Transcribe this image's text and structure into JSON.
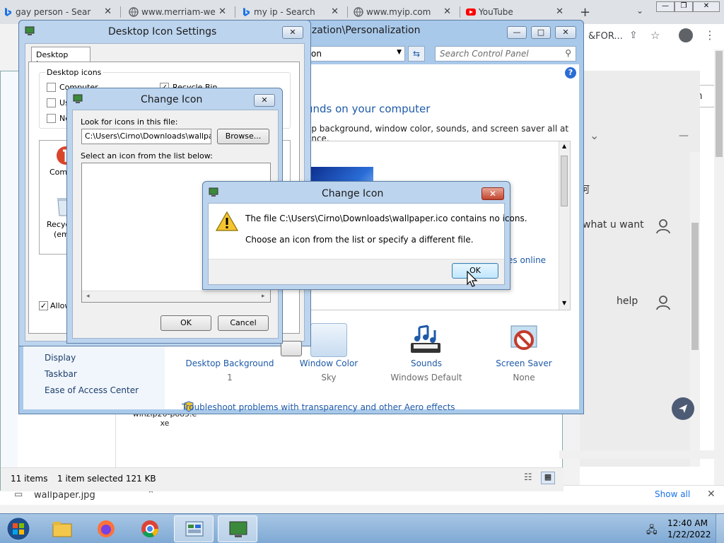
{
  "browser": {
    "tabs": [
      {
        "label": "gay person - Sear",
        "icon": "bing-icon"
      },
      {
        "label": "www.merriam-we",
        "icon": "globe-icon"
      },
      {
        "label": "my ip - Search",
        "icon": "bing-icon"
      },
      {
        "label": "www.myip.com",
        "icon": "globe-icon"
      },
      {
        "label": "YouTube",
        "icon": "youtube-icon"
      }
    ],
    "url_fragment": "&FOR...",
    "signin_label": "Sign in",
    "chat_fragment": "阿",
    "chat_message_1": "what u want",
    "chat_message_2": "help",
    "download_file": "wallpaper.jpg",
    "show_all": "Show all"
  },
  "explorer": {
    "file_label": "winzip20-poo5.exe",
    "status_items": "11 items",
    "status_selected": "1 item selected  121 KB"
  },
  "control_panel": {
    "title": "ization\\Personalization",
    "address": "on",
    "search_placeholder": "Search Control Panel",
    "heading": "unds on your computer",
    "subheading": "op background, window color, sounds, and screen saver all at once.",
    "themes_online_link": "es online",
    "see_also": [
      "Display",
      "Taskbar",
      "Ease of Access Center"
    ],
    "items": [
      {
        "label": "Desktop Background",
        "value": "1"
      },
      {
        "label": "Window Color",
        "value": "Sky"
      },
      {
        "label": "Sounds",
        "value": "Windows Default"
      },
      {
        "label": "Screen Saver",
        "value": "None"
      }
    ],
    "troubleshoot": "Troubleshoot problems with transparency and other Aero effects"
  },
  "desktop_icon_settings": {
    "title": "Desktop Icon Settings",
    "tab": "Desktop Icons",
    "group_label": "Desktop icons",
    "checkboxes": [
      {
        "label": "Computer",
        "checked": false
      },
      {
        "label": "Use",
        "checked": false
      },
      {
        "label": "Ne",
        "checked": false
      },
      {
        "label": "Recycle Bin",
        "checked": true
      }
    ],
    "icon_labels": [
      "Comp",
      "Recyc",
      "(emp"
    ],
    "allow_label": "Allow"
  },
  "change_icon": {
    "title": "Change Icon",
    "look_label": "Look for icons in this file:",
    "path": "C:\\Users\\Cirno\\Downloads\\wallpaper",
    "browse": "Browse...",
    "select_label": "Select an icon from the list below:",
    "ok": "OK",
    "cancel": "Cancel"
  },
  "error_dialog": {
    "title": "Change Icon",
    "message_line1": "The file C:\\Users\\Cirno\\Downloads\\wallpaper.ico contains no icons.",
    "message_line2": "Choose an icon from the list or specify a different file.",
    "ok": "OK",
    "close": "✕"
  },
  "taskbar": {
    "time": "12:40 AM",
    "date": "1/22/2022",
    "apps": [
      "file-explorer-icon",
      "firefox-icon",
      "chrome-icon",
      "control-panel-icon",
      "personalization-icon"
    ]
  },
  "colors": {
    "aero_frame": "#bcd4ee",
    "link_blue": "#1e5aa8",
    "taskbar": "#8fb3d9"
  }
}
